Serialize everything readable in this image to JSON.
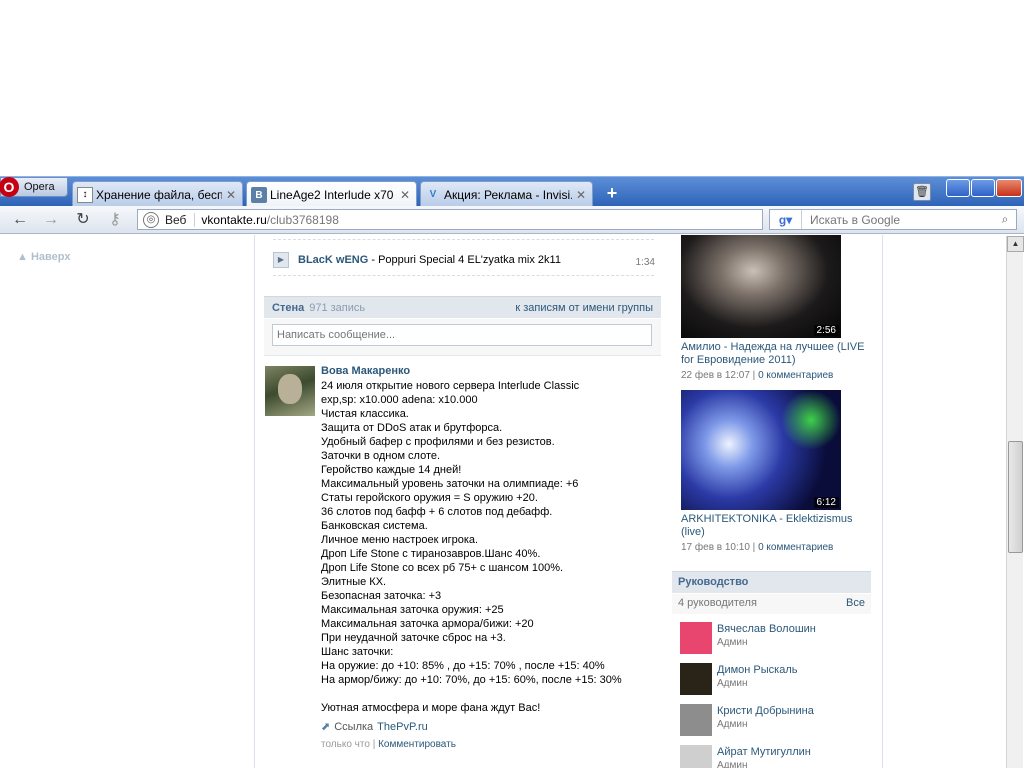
{
  "browser": {
    "menu_label": "Opera",
    "tabs": [
      {
        "title": "Хранение файла, беспл...",
        "icon": "tab-favicon-wave"
      },
      {
        "title": "LineAge2 Interlude x70 ...",
        "icon": "vk-favicon"
      },
      {
        "title": "Акция: Реклама - Invisi...",
        "icon": "tab-favicon-v"
      }
    ],
    "address": {
      "scope": "Веб",
      "host": "vkontakte.ru",
      "path": "/club3768198"
    },
    "search": {
      "engine": "google",
      "placeholder": "Искать в Google"
    }
  },
  "left": {
    "back_to_top": "Наверх"
  },
  "audio": {
    "artist": "BLacK wENG",
    "separator": " - ",
    "title": "Poppuri Special 4 EL'zyatka mix 2k11",
    "duration": "1:34"
  },
  "wall": {
    "title": "Стена",
    "count": "971 запись",
    "group_posts_link": "к записям от имени группы",
    "composer_placeholder": "Написать сообщение..."
  },
  "post": {
    "author": "Вова Макаренко",
    "lines": [
      "24 июля открытие нового сервера Interlude Classic",
      "exp,sp: x10.000 adena: x10.000",
      "Чистая классика.",
      "Защита от DDoS атак и брутфорса.",
      "Удобный бафер с профилями и без резистов.",
      "Заточки в одном слоте.",
      "Геройство каждые 14 дней!",
      "Максимальный уровень заточки на олимпиаде: +6",
      "Статы геройского оружия = S оружию +20.",
      "36 слотов под бафф + 6 слотов под дебафф.",
      "Банковская система.",
      "Личное меню настроек игрока.",
      "Дроп Life Stone с тиранозавров.Шанс 40%.",
      "Дроп Life Stone со всех рб 75+ с шансом 100%.",
      "Элитные КХ.",
      "Безопасная заточка: +3",
      "Максимальная заточка оружия: +25",
      "Максимальная заточка армора/бижи: +20",
      "При неудачной заточке сброс на +3.",
      "Шанс заточки:",
      "На оружие: до +10: 85% , до +15: 70% , после +15: 40%",
      "На армор/бижу: до +10: 70%, до +15: 60%, после +15: 30%",
      "",
      "Уютная атмосфера и море фана ждут Вас!"
    ],
    "link_label": "Ссылка",
    "link_url": "ThePvP.ru",
    "time": "только что",
    "comment_label": "Комментировать"
  },
  "videos": [
    {
      "title": "Амилио - Надежда на лучшее (LIVE for Евровидение 2011)",
      "duration": "2:56",
      "date": "22 фев в 12:07",
      "comments": "0 комментариев"
    },
    {
      "title": "ARKHITEKTONIKA - Eklektizismus (live)",
      "duration": "6:12",
      "date": "17 фев в 10:10",
      "comments": "0 комментариев"
    }
  ],
  "leadership": {
    "title": "Руководство",
    "count": "4 руководителя",
    "all_label": "Все",
    "members": [
      {
        "name": "Вячеслав Волошин",
        "role": "Админ",
        "color": "#e8466f"
      },
      {
        "name": "Димон Рыскаль",
        "role": "Админ",
        "color": "#2a2418"
      },
      {
        "name": "Кристи Добрынина",
        "role": "Админ",
        "color": "#8d8d8d"
      },
      {
        "name": "Айрат Мутигуллин",
        "role": "Админ",
        "color": "#cfcfcf"
      }
    ]
  },
  "colors": {
    "link": "#2b587a",
    "header_bg": "#e1e7ed",
    "tabbar": "#2e63b8"
  }
}
